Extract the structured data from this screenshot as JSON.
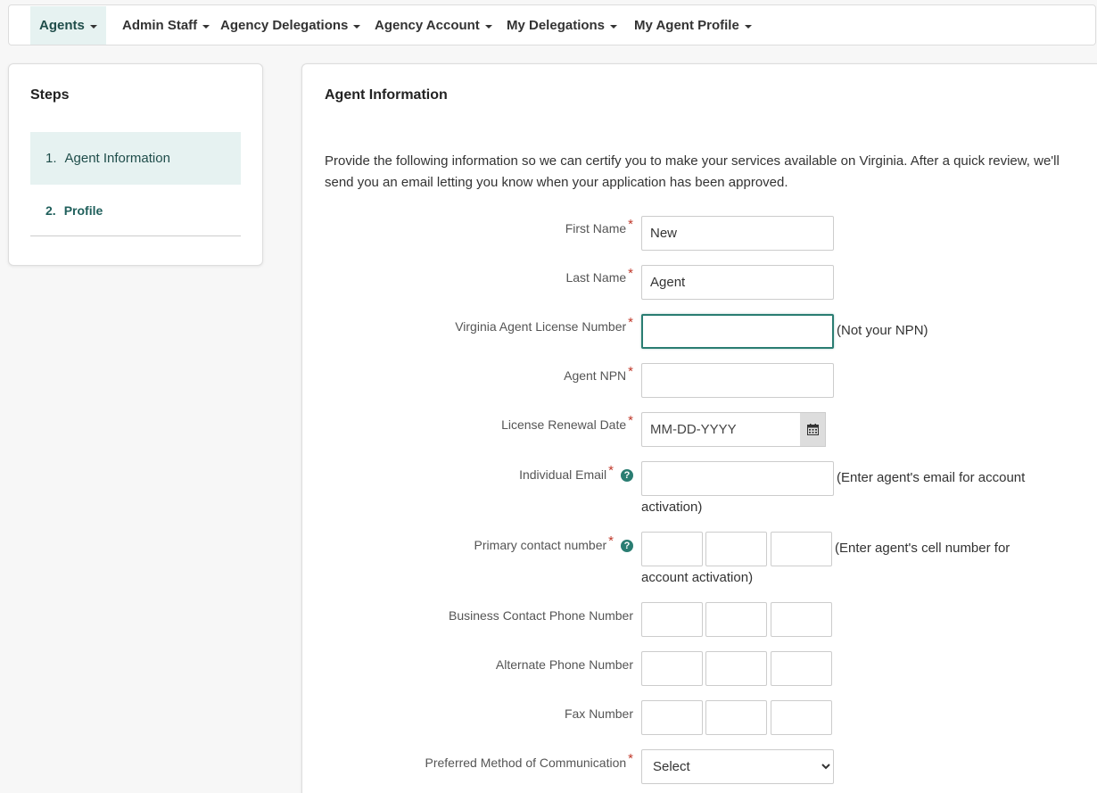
{
  "nav": {
    "agents": "Agents",
    "admin_staff": "Admin Staff",
    "agency_delegations": "Agency Delegations",
    "agency_account": "Agency Account",
    "my_delegations": "My Delegations",
    "my_agent_profile": "My Agent Profile"
  },
  "steps": {
    "title": "Steps",
    "items": [
      {
        "num": "1.",
        "label": "Agent Information"
      },
      {
        "num": "2.",
        "label": "Profile"
      }
    ]
  },
  "form": {
    "title": "Agent Information",
    "intro": "Provide the following information so we can certify you to make your services available on Virginia. After a quick review, we'll send you an email letting you know when your application has been approved.",
    "required_marker": "*",
    "help_glyph": "?",
    "first_name": {
      "label": "First Name",
      "value": "New"
    },
    "last_name": {
      "label": "Last Name",
      "value": "Agent"
    },
    "license_number": {
      "label": "Virginia Agent License Number",
      "value": "",
      "note": "(Not your NPN)"
    },
    "npn": {
      "label": "Agent NPN",
      "value": ""
    },
    "renewal_date": {
      "label": "License Renewal Date",
      "placeholder": "MM-DD-YYYY"
    },
    "email": {
      "label": "Individual Email",
      "value": "",
      "note_line1": "(Enter agent's email for account",
      "note_line2": "activation)"
    },
    "primary_phone": {
      "label": "Primary contact number",
      "note_line1": "(Enter agent's cell number for",
      "note_line2": "account activation)"
    },
    "business_phone": {
      "label": "Business Contact Phone Number"
    },
    "alternate_phone": {
      "label": "Alternate Phone Number"
    },
    "fax": {
      "label": "Fax Number"
    },
    "preferred_method": {
      "label": "Preferred Method of Communication",
      "selected": "Select"
    }
  },
  "colors": {
    "accent": "#2a7d72",
    "active_bg": "#e6f2f1",
    "required": "#c0392b"
  },
  "icons": {
    "calendar": "calendar-icon",
    "help": "question-circle-icon",
    "caret": "caret-down-icon"
  }
}
